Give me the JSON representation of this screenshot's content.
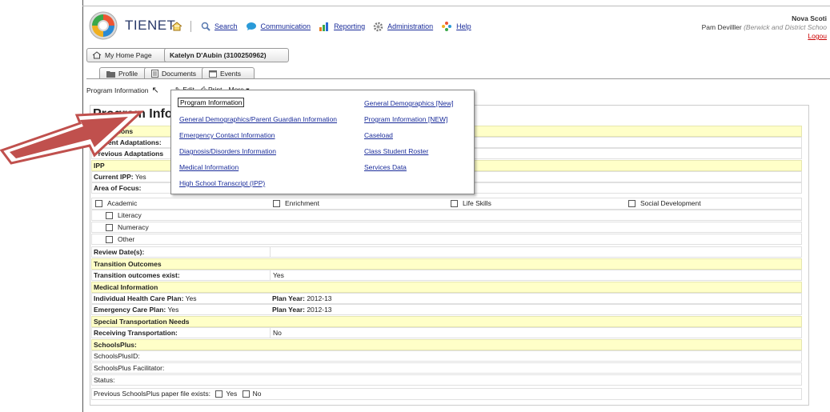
{
  "header": {
    "brand": "TIENET",
    "nav": {
      "search": "Search",
      "communication": "Communication",
      "reporting": "Reporting",
      "administration": "Administration",
      "help": "Help"
    },
    "user": {
      "org": "Nova Scoti",
      "name": "Pam Devilller",
      "school": "(Berwick and District Schoo",
      "logout": "Logou"
    }
  },
  "breadcrumb": {
    "home": "My Home Page",
    "student": "Katelyn D'Aubin (3100250962)"
  },
  "tabs": [
    "Profile",
    "Documents",
    "Events"
  ],
  "toolbar": {
    "program_info": "Program Information",
    "edit": "Edit",
    "print": "Print",
    "more": "More"
  },
  "page_title": "Program Inforn",
  "menu": {
    "left": [
      "Program Information",
      "General Demographics/Parent Guardian Information",
      "Emergency Contact Information",
      "Diagnosis/Disorders Information",
      "Medical Information",
      "High School Transcript (IPP)"
    ],
    "right": [
      "General Demographics [New]",
      "Program Information [NEW]",
      "Caseload",
      "Class Student Roster",
      "Services Data"
    ]
  },
  "form": {
    "adaptations": "Adaptations",
    "current_adaptations": "Current Adaptations:",
    "previous_adaptations": "Previous Adaptations",
    "ipp": "IPP",
    "current_ipp_label": "Current IPP:",
    "current_ipp_value": "Yes",
    "area_of_focus": "Area of Focus:",
    "focus_areas": [
      "Academic",
      "Enrichment",
      "Life Skills",
      "Social Development"
    ],
    "academic_sub": [
      "Literacy",
      "Numeracy",
      "Other"
    ],
    "review_dates": "Review Date(s):",
    "transition_outcomes": "Transition Outcomes",
    "transition_exist_label": "Transition outcomes exist:",
    "transition_exist_value": "Yes",
    "medical_information": "Medical Information",
    "ihcp_label": "Individual Health Care Plan:",
    "ihcp_value": "Yes",
    "plan_year_label": "Plan Year:",
    "plan_year_1": "2012-13",
    "ecp_label": "Emergency Care Plan:",
    "ecp_value": "Yes",
    "plan_year_2": "2012-13",
    "special_transport": "Special Transportation Needs",
    "receiving_transport_label": "Receiving Transportation:",
    "receiving_transport_value": "No",
    "schoolsplus": "SchoolsPlus:",
    "schoolsplus_id": "SchoolsPlusID:",
    "schoolsplus_facilitator": "SchoolsPlus Facilitator:",
    "status": "Status:",
    "previous_file": "Previous SchoolsPlus paper file exists:",
    "yes": "Yes",
    "no": "No"
  },
  "colors": {
    "header_row_bg": "#ffffc8",
    "link": "#1a2c9a",
    "arrow": "#c0504d"
  }
}
